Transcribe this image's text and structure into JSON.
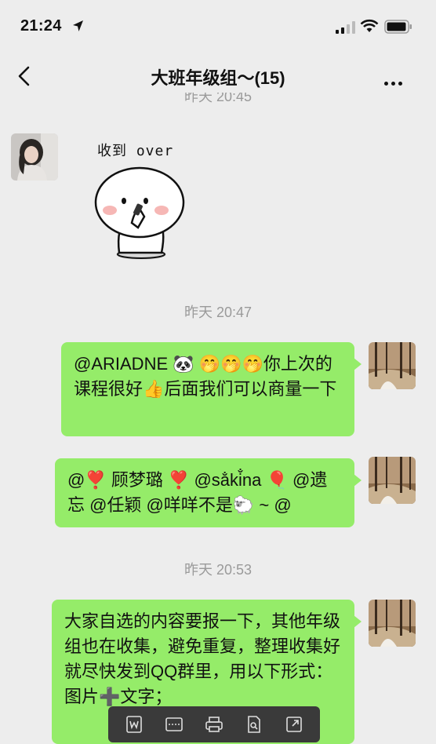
{
  "status": {
    "time": "21:24"
  },
  "nav": {
    "title": "大班年级组～(15)"
  },
  "timestamps": {
    "cut": "昨天 20:45",
    "t1": "昨天 20:47",
    "t2": "昨天 20:53"
  },
  "sticker": {
    "caption": "收到 over"
  },
  "messages": {
    "m1": "@ARIADNE 🐼 🤭🤭🤭你上次的课程很好👍后面我们可以商量一下",
    "m2": "@❣️ 顾梦璐 ❣️ @sa̐ki̐na 🎈 @遗忘 @任颖 @咩咩不是🐑 ~ @",
    "m3": "大家自选的内容要报一下，其他年级组也在收集，避免重复，整理收集好就尽快发到QQ群里，用以下形式：图片➕文字；"
  },
  "colors": {
    "bubble": "#95ec69",
    "background": "#ededed"
  },
  "icons": [
    "location-arrow-icon",
    "signal-icon",
    "wifi-icon",
    "battery-icon",
    "back-chevron-icon",
    "more-icon",
    "word-icon",
    "scan-icon",
    "print-icon",
    "search-doc-icon",
    "external-icon"
  ]
}
